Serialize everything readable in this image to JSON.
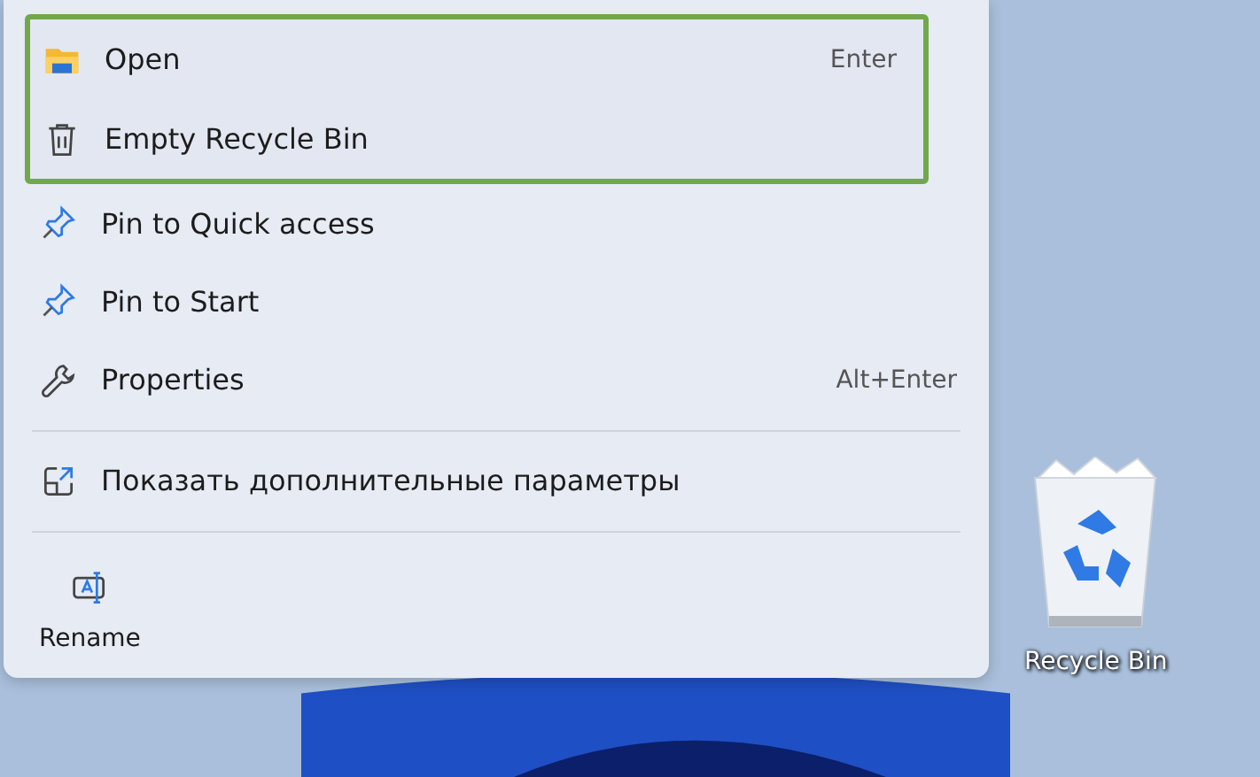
{
  "context_menu": {
    "items": [
      {
        "kind": "folder",
        "label": "Open",
        "shortcut": "Enter",
        "highlighted": true
      },
      {
        "kind": "trash",
        "label": "Empty Recycle Bin",
        "highlighted": true
      },
      {
        "kind": "pin",
        "label": "Pin to Quick access",
        "highlighted": false
      },
      {
        "kind": "pin",
        "label": "Pin to Start",
        "highlighted": false
      },
      {
        "kind": "wrench",
        "label": "Properties",
        "shortcut": "Alt+Enter",
        "highlighted": false
      },
      {
        "kind": "separator"
      },
      {
        "kind": "external",
        "label": "Показать дополнительные параметры",
        "highlighted": false
      },
      {
        "kind": "separator"
      }
    ],
    "actions": [
      {
        "kind": "rename",
        "label": "Rename"
      }
    ]
  },
  "desktop_icon": {
    "label": "Recycle Bin"
  }
}
